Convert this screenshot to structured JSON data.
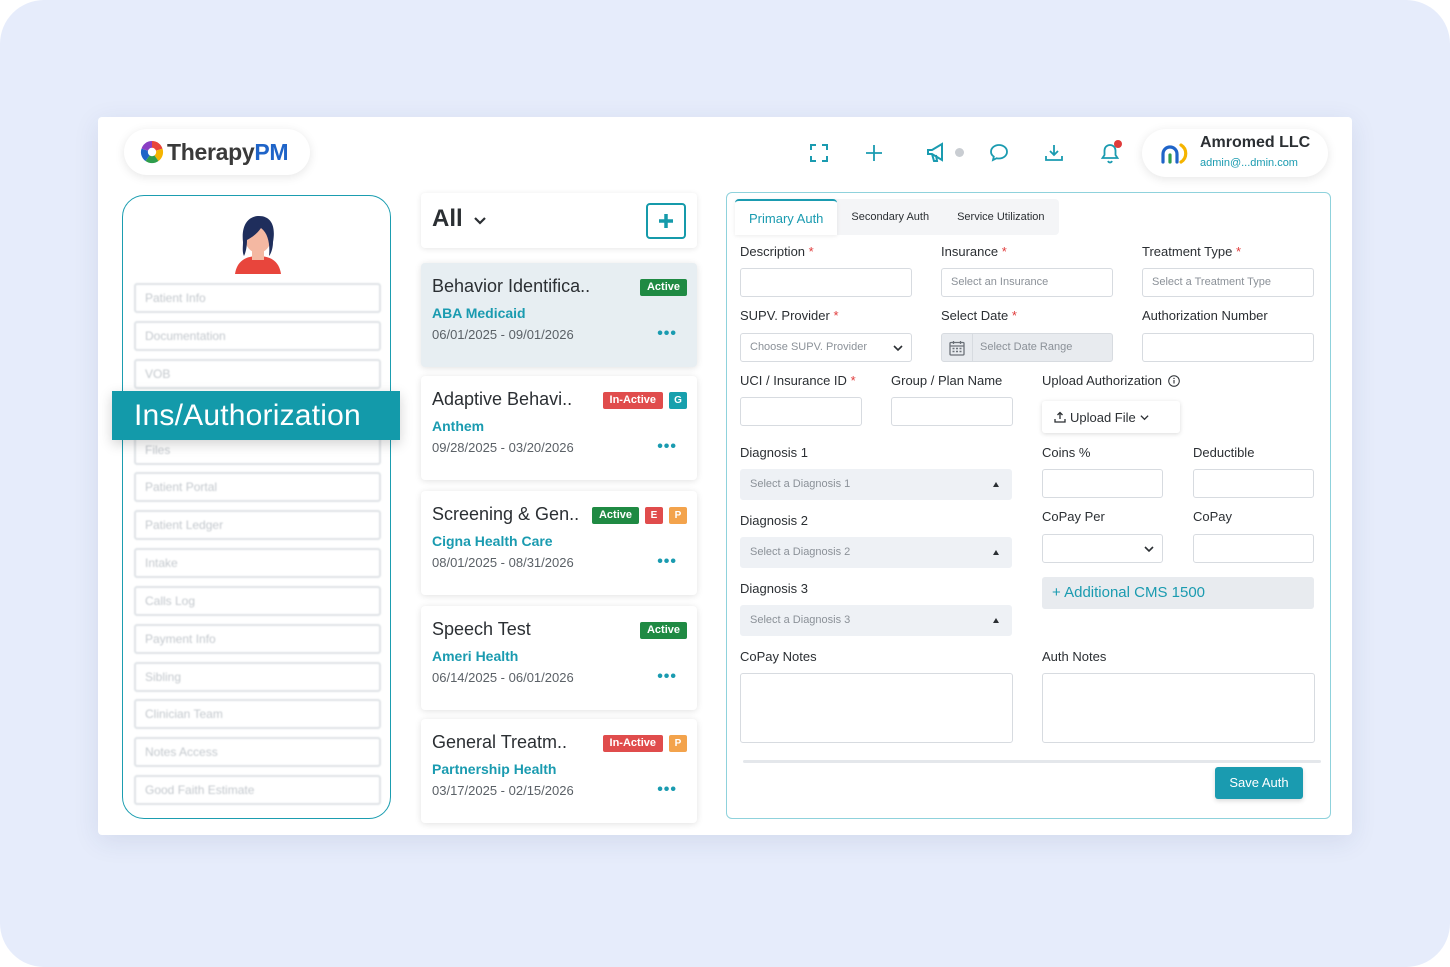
{
  "brand": {
    "name_part1": "Therapy",
    "name_part2": "PM"
  },
  "header": {
    "icons": [
      "expand-icon",
      "plus-icon",
      "megaphone-icon",
      "chat-icon",
      "download-icon",
      "bell-icon"
    ],
    "user": {
      "org": "Amromed LLC",
      "email": "admin@...dmin.com"
    }
  },
  "sidebar": {
    "banner": "Ins/Authorization",
    "items": [
      "Patient Info",
      "Documentation",
      "VOB",
      "Files",
      "Patient Portal",
      "Patient Ledger",
      "Intake",
      "Calls Log",
      "Payment Info",
      "Sibling",
      "Clinician Team",
      "Notes Access",
      "Good Faith Estimate"
    ]
  },
  "list": {
    "filter": "All",
    "cards": [
      {
        "title": "Behavior Identifica..",
        "insurance": "ABA  Medicaid",
        "dates": "06/01/2025 - 09/01/2026",
        "status": "Active",
        "tags": [],
        "dots": "•••"
      },
      {
        "title": "Adaptive Behavi..",
        "insurance": "Anthem",
        "dates": "09/28/2025 - 03/20/2026",
        "status": "In-Active",
        "tags": [
          "G"
        ],
        "dots": "•••"
      },
      {
        "title": "Screening & Gen..",
        "insurance": "Cigna Health Care",
        "dates": "08/01/2025 - 08/31/2026",
        "status": "Active",
        "tags": [
          "E",
          "P"
        ],
        "dots": "•••"
      },
      {
        "title": "Speech Test",
        "insurance": "Ameri Health",
        "dates": "06/14/2025 - 06/01/2026",
        "status": "Active",
        "tags": [],
        "dots": "•••"
      },
      {
        "title": "General Treatm..",
        "insurance": "Partnership Health",
        "dates": "03/17/2025 - 02/15/2026",
        "status": "In-Active",
        "tags": [
          "P"
        ],
        "dots": "•••"
      }
    ]
  },
  "form": {
    "tabs": [
      "Primary Auth",
      "Secondary Auth",
      "Service Utilization"
    ],
    "labels": {
      "description": "Description",
      "insurance": "Insurance",
      "treatment_type": "Treatment Type",
      "supv_provider": "SUPV. Provider",
      "select_date": "Select Date",
      "auth_number": "Authorization Number",
      "uci": "UCI / Insurance ID",
      "group": "Group / Plan Name",
      "upload_auth": "Upload Authorization",
      "diagnosis1": "Diagnosis 1",
      "diagnosis2": "Diagnosis 2",
      "diagnosis3": "Diagnosis 3",
      "coins": "Coins %",
      "deductible": "Deductible",
      "copay_per": "CoPay Per",
      "copay": "CoPay",
      "copay_notes": "CoPay Notes",
      "auth_notes": "Auth Notes"
    },
    "placeholders": {
      "insurance": "Select an Insurance",
      "treatment_type": "Select a Treatment Type",
      "supv_provider": "Choose SUPV. Provider",
      "date_range": "Select Date Range",
      "diagnosis1": "Select a Diagnosis 1",
      "diagnosis2": "Select a Diagnosis 2",
      "diagnosis3": "Select a Diagnosis 3"
    },
    "upload_button": "Upload File",
    "cms_button": "+ Additional CMS 1500",
    "save_button": "Save Auth",
    "required_mark": "*"
  },
  "colors": {
    "accent": "#1a9bb0",
    "active": "#1f8a43",
    "inactive": "#e04c4c",
    "tag_e": "#e04c4c",
    "tag_p": "#f3a34c",
    "tag_g": "#17a0ad"
  }
}
